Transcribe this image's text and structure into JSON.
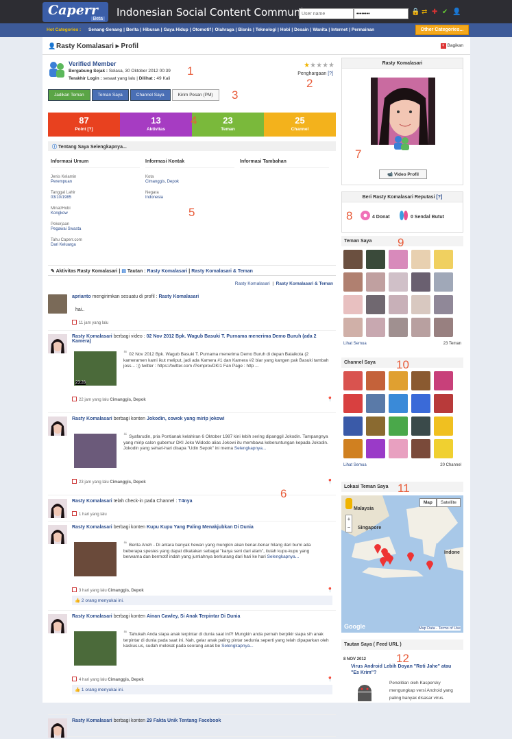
{
  "header": {
    "logo": "Caperr",
    "logo_badge": "Beta",
    "tagline": "Indonesian Social Content Community",
    "username_placeholder": "User name",
    "password_value": "••••••••"
  },
  "categories": {
    "label": "Hot Categories :",
    "items": [
      "Senang-Senang",
      "Berita",
      "Hiburan",
      "Gaya Hidup",
      "Otomotif",
      "Olahraga",
      "Bisnis",
      "Teknologi",
      "Hobi",
      "Desain",
      "Wanita",
      "Internet",
      "Permainan"
    ],
    "other": "Other Categories..."
  },
  "profile": {
    "crumb_name": "Rasty Komalasari",
    "crumb_sep": "▸",
    "crumb_page": "Profil",
    "share": "Bagikan",
    "verified": "Verified Member",
    "joined_label": "Bergabung Sejak :",
    "joined": "Selasa, 30 Oktober 2012 00:39",
    "lastlogin_label": "Terakhir Login :",
    "lastlogin": "sesaat yang lalu",
    "seen_label": "Dilihat :",
    "seen": "49 Kali",
    "reward": "Penghargaan",
    "reward_help": "[?]"
  },
  "buttons": [
    "Jadikan Teman",
    "Teman Saya",
    "Channel Saya",
    "Kirim Pesan (PM)"
  ],
  "stats": [
    {
      "n": "87",
      "l": "Point",
      "x": "[?]",
      "c": "#e8411f"
    },
    {
      "n": "13",
      "l": "Aktivitas",
      "c": "#a63cc2"
    },
    {
      "n": "23",
      "l": "Teman",
      "c": "#7ab93b"
    },
    {
      "n": "25",
      "l": "Channel",
      "c": "#f3b21c"
    }
  ],
  "about": {
    "title": "Tentang Saya Selengkapnya...",
    "cols": [
      "Informasi Umum",
      "Informasi Kontak",
      "Informasi Tambahan"
    ],
    "umum": [
      {
        "k": "Jenis Kelamin",
        "v": "Perempuan"
      },
      {
        "k": "Tanggal Lahir",
        "v": "03/10/1985"
      },
      {
        "k": "Minat/Hobi",
        "v": "Kongkow"
      },
      {
        "k": "Pekerjaan",
        "v": "Pegawai Swasta"
      },
      {
        "k": "Tahu Caperr.com",
        "v": "Dari Keluarga"
      }
    ],
    "kontak": [
      {
        "k": "Kota",
        "v": "Cimanggis, Depok"
      },
      {
        "k": "Negara",
        "v": "Indonesia"
      }
    ]
  },
  "activity": {
    "title": "Aktivitas Rasty Komalasari",
    "tautan": "Tautan :",
    "link1": "Rasty Komalasari",
    "sep": "|",
    "link2": "Rasty Komalasari & Teman",
    "filter1": "Rasty Komalasari",
    "filter2": "Rasty Komalasari & Teman"
  },
  "feed": [
    {
      "user": "aprianto",
      "verb": "mengirimkan sesuatu di profil :",
      "target": "Rasty Komalasari",
      "body": "hai..",
      "time": "11 jam yang lalu"
    },
    {
      "user": "Rasty Komalasari",
      "verb": "berbagi video :",
      "target": "02 Nov 2012 Bpk. Wagub Basuki T. Purnama menerima Demo Buruh (ada 2 Kamera)",
      "body": "02 Nov 2012 Bpk. Wagub Basuki T. Purnama menerima Demo Buruh di depan Balaikota (2 kameramen kami ikut meliput, jadi ada Kamera #1 dan Kamera #2 biar yang kangen pak Basuki tambah joss... :)) twitter : https://twitter.com /PemprovDKI1 Fan Page : http ...",
      "time": "22 jam yang lalu",
      "loc": "Cimanggis, Depok",
      "dur": "23:28"
    },
    {
      "user": "Rasty Komalasari",
      "verb": "berbagi konten",
      "target": "Jokodin, cowok yang mirip jokowi",
      "body": "Syafarudin, pria Pontianak kelahiran 6 Oktober 1987 kini lebih sering dipanggil Jokodin. Tampangnya yang mirip calon gubernur DKI Joko Widodo alias Jokowi itu membawa keberuntungan kepada Jokodin. Jokodin yang sehari-hari disapa \"Udin Sepok\" ini mema",
      "more": "Selengkapnya...",
      "time": "23 jam yang lalu",
      "loc": "Cimanggis, Depok"
    },
    {
      "user": "Rasty Komalasari",
      "verb": "telah check-in pada Channel :",
      "target": "T4nya",
      "time": "1 hari yang lalu"
    },
    {
      "user": "Rasty Komalasari",
      "verb": "berbagi konten",
      "target": "Kupu Kupu Yang Paling Menakjubkan Di Dunia",
      "body": "Berita Aneh - Di antara banyak hewan yang mungkin akan benar-benar hilang dari bumi ada beberapa spesies yang dapat dikatakan sebagai \"karya seni dari alam\", itulah kupu-kupu yang berwarna dan bermotif indah yang jumlahnya berkurang dari hari ke hari",
      "more": "Selengkapnya...",
      "time": "3 hari yang lalu",
      "loc": "Cimanggis, Depok",
      "likes": "2 orang menyukai ini."
    },
    {
      "user": "Rasty Komalasari",
      "verb": "berbagi konten",
      "target": "Ainan Cawley, Si Anak Terpintar Di Dunia",
      "body": "Tahukah Anda siapa anak terpintar di dunia saat ini?! Mungkin anda pernah berpikir siapa sih anak terpintar di dunia pada saat ini. Nah, gelar anak paling pintar sedunia seperti yang telah dipaparkan oleh kaskus.us, sudah melekat pada seorang anak be",
      "more": "Selengkapnya...",
      "time": "4 hari yang lalu",
      "loc": "Cimanggis, Depok",
      "likes": "1 orang menyukai ini."
    },
    {
      "user": "Rasty Komalasari",
      "verb": "berbagi konten",
      "target": "29 Fakta Unik Tentang Facebook"
    }
  ],
  "side": {
    "name": "Rasty Komalasari",
    "video": "Video Profil",
    "rep_title": "Beri Rasty Komalasari Reputasi",
    "rep_help": "[?]",
    "donat": "4 Donat",
    "sendal": "0 Sendal Butut",
    "friends_title": "Teman Saya",
    "see_all": "Lihat Semua",
    "friends_count": "23 Teman",
    "channel_title": "Channel Saya",
    "channel_count": "20 Channel",
    "map_title": "Lokasi Teman Saya",
    "map_btn": "Map",
    "sat_btn": "Satellite",
    "map_l1": "Malaysia",
    "map_l2": "Singapore",
    "map_l3": "Indone",
    "google": "Google",
    "mapdata": "Map Data",
    "terms": "Terms of Use",
    "feed_title": "Tautan Saya ( Feed URL )",
    "feed_date": "8 NOV 2012",
    "feed_head": "Virus Android Lebih Doyan \"Roti Jahe\" atau \"Es Krim\"?",
    "feed_body": "Penelitian oleh Kaspersky mengungkap versi Android yang paling banyak disasar virus."
  },
  "annotations": [
    "1",
    "2",
    "3",
    "4",
    "5",
    "6",
    "7",
    "8",
    "9",
    "10",
    "11",
    "12"
  ]
}
